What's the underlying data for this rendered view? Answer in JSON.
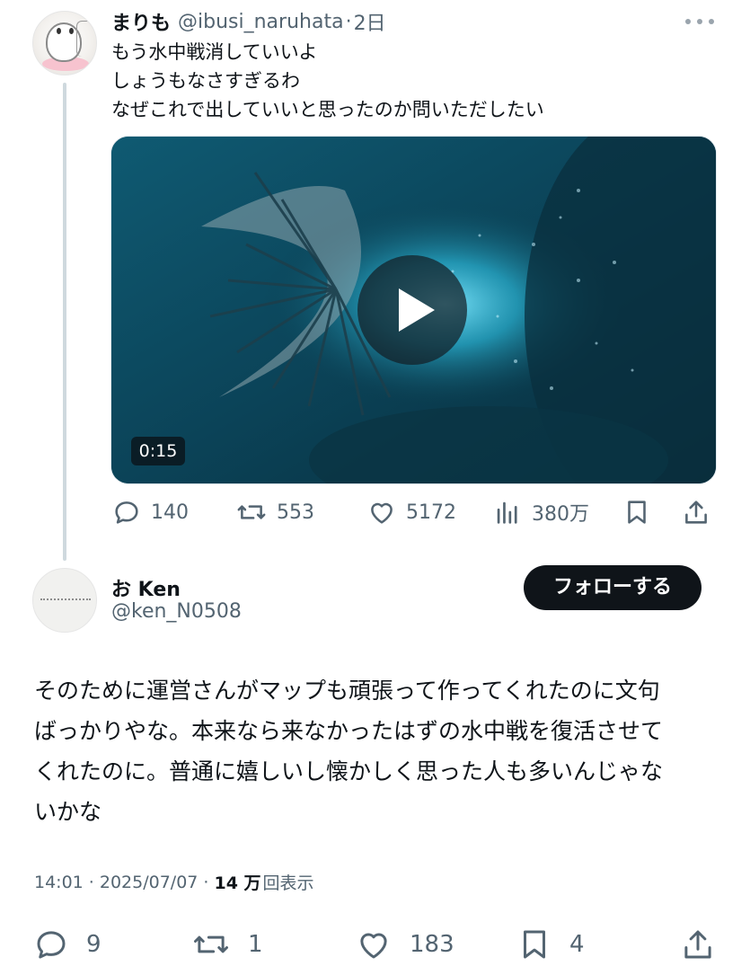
{
  "parent_tweet": {
    "display_name": "まりも",
    "handle": "@ibusi_naruhata",
    "separator": "·",
    "time": "2日",
    "lines": [
      "もう水中戦消していいよ",
      "しょうもなさすぎるわ",
      "なぜこれで出していいと思ったのか問いただしたい"
    ],
    "video": {
      "duration": "0:15"
    },
    "stats": {
      "replies": "140",
      "reposts": "553",
      "likes": "5172",
      "views": "380万"
    }
  },
  "reply_tweet": {
    "display_name": "お Ken",
    "handle": "@ken_N0508",
    "follow_label": "フォローする",
    "lines": [
      "そのために運営さんがマップも頑張って作ってくれたのに文句",
      "ばっかりやな。本来なら来なかったはずの水中戦を復活させて",
      "くれたのに。普通に嬉しいし懐かしく思った人も多いんじゃな",
      "いかな"
    ],
    "timestamp": "14:01 · 2025/07/07 ·",
    "views_count": "14 万",
    "views_label": "回表示",
    "stats": {
      "replies": "9",
      "reposts": "1",
      "likes": "183",
      "bookmarks": "4"
    }
  },
  "colors": {
    "text": "#0f1419",
    "secondary": "#536471",
    "thread_line": "#cfd9de",
    "follow_bg": "#0f1419"
  },
  "icons": [
    "reply-icon",
    "repost-icon",
    "like-icon",
    "views-icon",
    "bookmark-icon",
    "share-icon",
    "more-icon",
    "play-icon"
  ]
}
